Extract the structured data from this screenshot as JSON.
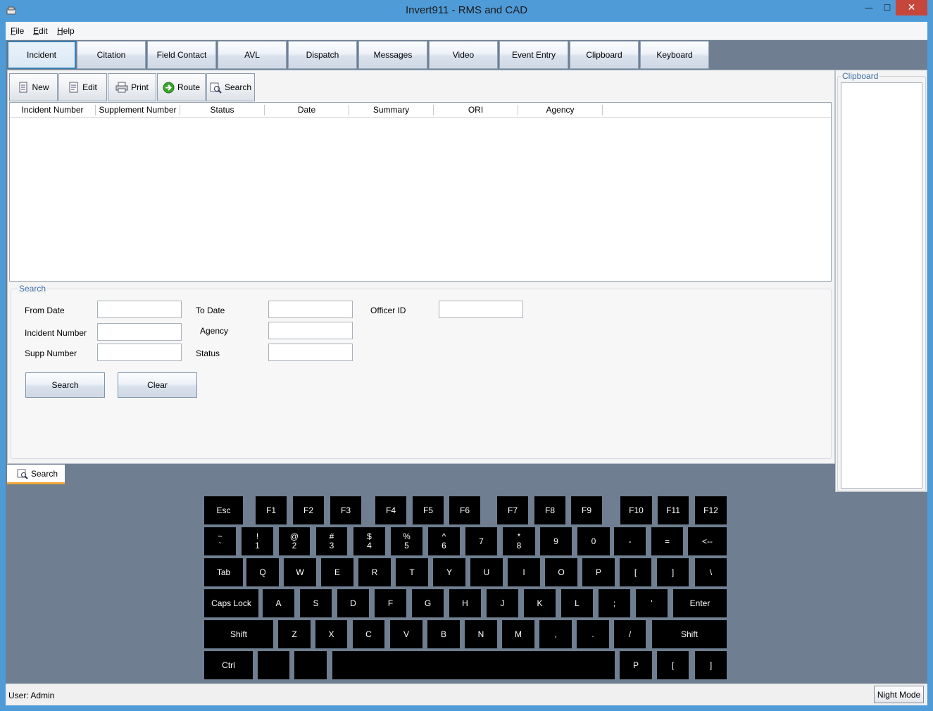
{
  "window": {
    "title": "Invert911 - RMS and CAD",
    "close_glyph": "✕",
    "min_glyph": "—",
    "max_glyph": "☐"
  },
  "menu": [
    {
      "u": "F",
      "rest": "ile"
    },
    {
      "u": "E",
      "rest": "dit"
    },
    {
      "u": "H",
      "rest": "elp"
    }
  ],
  "modules": [
    "Incident",
    "Citation",
    "Field Contact",
    "AVL",
    "Dispatch",
    "Messages",
    "Video",
    "Event Entry",
    "Clipboard",
    "Keyboard"
  ],
  "toolbar": {
    "new": "New",
    "edit": "Edit",
    "print": "Print",
    "route": "Route",
    "search": "Search"
  },
  "grid_columns": [
    "Incident Number",
    "Supplement Number",
    "Status",
    "Date",
    "Summary",
    "ORI",
    "Agency"
  ],
  "search": {
    "legend": "Search",
    "from_date": "From Date",
    "to_date": "To Date",
    "officer_id": "Officer ID",
    "incident_number": "Incident Number",
    "agency": "Agency",
    "supp_number": "Supp Number",
    "status": "Status",
    "search_button": "Search",
    "clear_button": "Clear"
  },
  "bottom_tab": "Search",
  "clipboard": {
    "legend": "Clipboard"
  },
  "keyboard": {
    "row0": [
      "Esc",
      "F1",
      "F2",
      "F3",
      "F4",
      "F5",
      "F6",
      "F7",
      "F8",
      "F9",
      "F10",
      "F11",
      "F12"
    ],
    "row1": [
      [
        "~",
        "`"
      ],
      [
        "!",
        "1"
      ],
      [
        "@",
        "2"
      ],
      [
        "#",
        "3"
      ],
      [
        "$",
        "4"
      ],
      [
        "%",
        "5"
      ],
      [
        "^",
        "6"
      ],
      [
        "",
        "7"
      ],
      [
        "*",
        "8"
      ],
      [
        "9"
      ],
      [
        "0"
      ],
      [
        "-"
      ],
      [
        "="
      ],
      [
        "<--"
      ]
    ],
    "row2": [
      "Tab",
      "Q",
      "W",
      "E",
      "R",
      "T",
      "Y",
      "U",
      "I",
      "O",
      "P",
      "[",
      "]",
      "\\"
    ],
    "row3": [
      "Caps Lock",
      "A",
      "S",
      "D",
      "F",
      "G",
      "H",
      "J",
      "K",
      "L",
      ";",
      "'",
      "Enter"
    ],
    "row4": [
      "Shift",
      "Z",
      "X",
      "C",
      "V",
      "B",
      "N",
      "M",
      ",",
      ".",
      "/",
      "Shift"
    ],
    "row5": [
      "Ctrl",
      "",
      "",
      "",
      "P",
      "[",
      "]"
    ]
  },
  "status": {
    "user": "User: Admin",
    "night_mode": "Night Mode"
  }
}
